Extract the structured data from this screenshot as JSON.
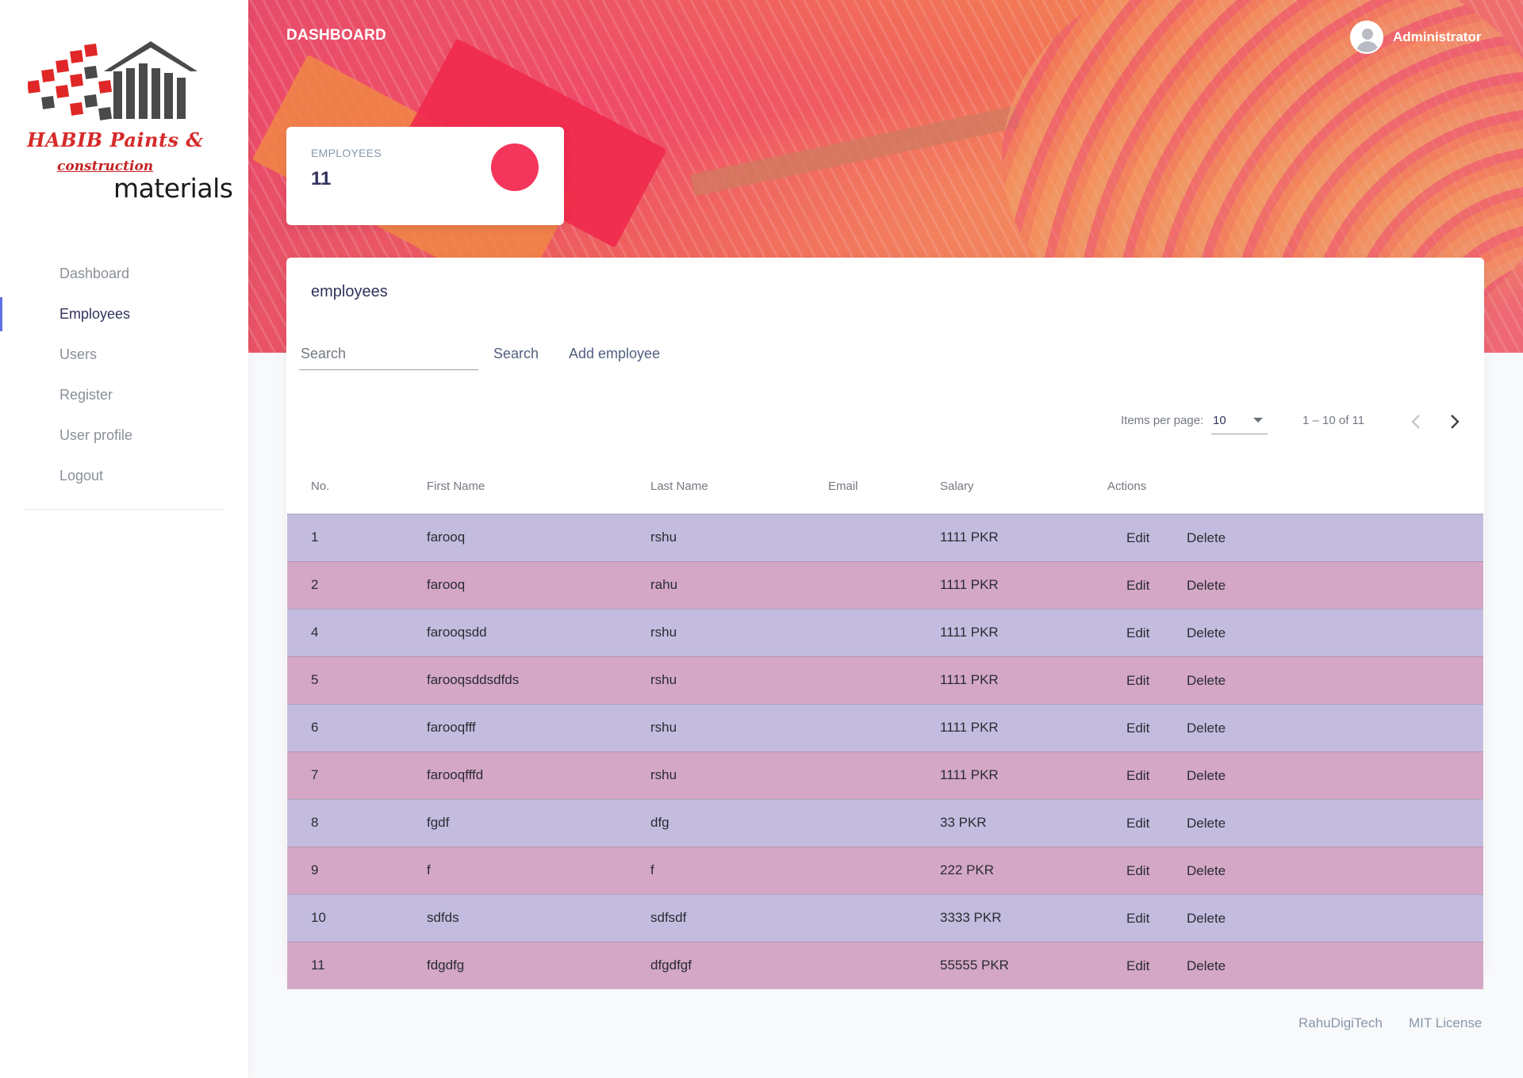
{
  "brand": {
    "logo_line1": "HABIB Paints &",
    "logo_line2": "construction",
    "logo_line3": "materials",
    "colors": {
      "red": "#d62a2a",
      "dark": "#4a4a4a"
    }
  },
  "sidebar": {
    "items": [
      {
        "label": "Dashboard",
        "active": false
      },
      {
        "label": "Employees",
        "active": true
      },
      {
        "label": "Users",
        "active": false
      },
      {
        "label": "Register",
        "active": false
      },
      {
        "label": "User profile",
        "active": false
      },
      {
        "label": "Logout",
        "active": false
      }
    ]
  },
  "header": {
    "title": "DASHBOARD",
    "user_name": "Administrator"
  },
  "stat": {
    "title": "EMPLOYEES",
    "value": "11",
    "icon_color": "#f5365c"
  },
  "main": {
    "title": "employees",
    "search": {
      "placeholder": "Search",
      "value": ""
    },
    "search_label": "Search",
    "add_label": "Add employee",
    "paginator": {
      "items_per_page_label": "Items per page:",
      "items_per_page": "10",
      "range": "1 – 10 of 11"
    },
    "columns": [
      "No.",
      "First Name",
      "Last Name",
      "Email",
      "Salary",
      "Actions"
    ],
    "rows": [
      {
        "no": "1",
        "first": "farooq",
        "last": "rshu",
        "email": "",
        "salary": "1111 PKR"
      },
      {
        "no": "2",
        "first": "farooq",
        "last": "rahu",
        "email": "",
        "salary": "1111 PKR"
      },
      {
        "no": "4",
        "first": "farooqsdd",
        "last": "rshu",
        "email": "",
        "salary": "1111 PKR"
      },
      {
        "no": "5",
        "first": "farooqsddsdfds",
        "last": "rshu",
        "email": "",
        "salary": "1111 PKR"
      },
      {
        "no": "6",
        "first": "farooqfff",
        "last": "rshu",
        "email": "",
        "salary": "1111 PKR"
      },
      {
        "no": "7",
        "first": "farooqfffd",
        "last": "rshu",
        "email": "",
        "salary": "1111 PKR"
      },
      {
        "no": "8",
        "first": "fgdf",
        "last": "dfg",
        "email": "",
        "salary": "33 PKR"
      },
      {
        "no": "9",
        "first": "f",
        "last": "f",
        "email": "",
        "salary": "222 PKR"
      },
      {
        "no": "10",
        "first": "sdfds",
        "last": "sdfsdf",
        "email": "",
        "salary": "3333 PKR"
      },
      {
        "no": "11",
        "first": "fdgdfg",
        "last": "dfgdfgf",
        "email": "",
        "salary": "55555 PKR"
      }
    ],
    "edit_label": "Edit",
    "delete_label": "Delete",
    "row_colors": {
      "odd": "#c3bcdf",
      "even": "#d4a7c6"
    }
  },
  "footer": {
    "links": [
      "RahuDigiTech",
      "MIT License"
    ]
  }
}
